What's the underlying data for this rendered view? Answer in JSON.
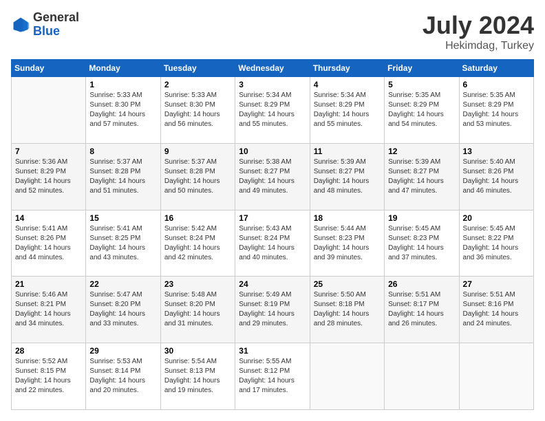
{
  "header": {
    "logo_general": "General",
    "logo_blue": "Blue",
    "title": "July 2024",
    "location": "Hekimdag, Turkey"
  },
  "weekdays": [
    "Sunday",
    "Monday",
    "Tuesday",
    "Wednesday",
    "Thursday",
    "Friday",
    "Saturday"
  ],
  "weeks": [
    [
      {
        "day": "",
        "info": ""
      },
      {
        "day": "1",
        "info": "Sunrise: 5:33 AM\nSunset: 8:30 PM\nDaylight: 14 hours\nand 57 minutes."
      },
      {
        "day": "2",
        "info": "Sunrise: 5:33 AM\nSunset: 8:30 PM\nDaylight: 14 hours\nand 56 minutes."
      },
      {
        "day": "3",
        "info": "Sunrise: 5:34 AM\nSunset: 8:29 PM\nDaylight: 14 hours\nand 55 minutes."
      },
      {
        "day": "4",
        "info": "Sunrise: 5:34 AM\nSunset: 8:29 PM\nDaylight: 14 hours\nand 55 minutes."
      },
      {
        "day": "5",
        "info": "Sunrise: 5:35 AM\nSunset: 8:29 PM\nDaylight: 14 hours\nand 54 minutes."
      },
      {
        "day": "6",
        "info": "Sunrise: 5:35 AM\nSunset: 8:29 PM\nDaylight: 14 hours\nand 53 minutes."
      }
    ],
    [
      {
        "day": "7",
        "info": "Sunrise: 5:36 AM\nSunset: 8:29 PM\nDaylight: 14 hours\nand 52 minutes."
      },
      {
        "day": "8",
        "info": "Sunrise: 5:37 AM\nSunset: 8:28 PM\nDaylight: 14 hours\nand 51 minutes."
      },
      {
        "day": "9",
        "info": "Sunrise: 5:37 AM\nSunset: 8:28 PM\nDaylight: 14 hours\nand 50 minutes."
      },
      {
        "day": "10",
        "info": "Sunrise: 5:38 AM\nSunset: 8:27 PM\nDaylight: 14 hours\nand 49 minutes."
      },
      {
        "day": "11",
        "info": "Sunrise: 5:39 AM\nSunset: 8:27 PM\nDaylight: 14 hours\nand 48 minutes."
      },
      {
        "day": "12",
        "info": "Sunrise: 5:39 AM\nSunset: 8:27 PM\nDaylight: 14 hours\nand 47 minutes."
      },
      {
        "day": "13",
        "info": "Sunrise: 5:40 AM\nSunset: 8:26 PM\nDaylight: 14 hours\nand 46 minutes."
      }
    ],
    [
      {
        "day": "14",
        "info": "Sunrise: 5:41 AM\nSunset: 8:26 PM\nDaylight: 14 hours\nand 44 minutes."
      },
      {
        "day": "15",
        "info": "Sunrise: 5:41 AM\nSunset: 8:25 PM\nDaylight: 14 hours\nand 43 minutes."
      },
      {
        "day": "16",
        "info": "Sunrise: 5:42 AM\nSunset: 8:24 PM\nDaylight: 14 hours\nand 42 minutes."
      },
      {
        "day": "17",
        "info": "Sunrise: 5:43 AM\nSunset: 8:24 PM\nDaylight: 14 hours\nand 40 minutes."
      },
      {
        "day": "18",
        "info": "Sunrise: 5:44 AM\nSunset: 8:23 PM\nDaylight: 14 hours\nand 39 minutes."
      },
      {
        "day": "19",
        "info": "Sunrise: 5:45 AM\nSunset: 8:23 PM\nDaylight: 14 hours\nand 37 minutes."
      },
      {
        "day": "20",
        "info": "Sunrise: 5:45 AM\nSunset: 8:22 PM\nDaylight: 14 hours\nand 36 minutes."
      }
    ],
    [
      {
        "day": "21",
        "info": "Sunrise: 5:46 AM\nSunset: 8:21 PM\nDaylight: 14 hours\nand 34 minutes."
      },
      {
        "day": "22",
        "info": "Sunrise: 5:47 AM\nSunset: 8:20 PM\nDaylight: 14 hours\nand 33 minutes."
      },
      {
        "day": "23",
        "info": "Sunrise: 5:48 AM\nSunset: 8:20 PM\nDaylight: 14 hours\nand 31 minutes."
      },
      {
        "day": "24",
        "info": "Sunrise: 5:49 AM\nSunset: 8:19 PM\nDaylight: 14 hours\nand 29 minutes."
      },
      {
        "day": "25",
        "info": "Sunrise: 5:50 AM\nSunset: 8:18 PM\nDaylight: 14 hours\nand 28 minutes."
      },
      {
        "day": "26",
        "info": "Sunrise: 5:51 AM\nSunset: 8:17 PM\nDaylight: 14 hours\nand 26 minutes."
      },
      {
        "day": "27",
        "info": "Sunrise: 5:51 AM\nSunset: 8:16 PM\nDaylight: 14 hours\nand 24 minutes."
      }
    ],
    [
      {
        "day": "28",
        "info": "Sunrise: 5:52 AM\nSunset: 8:15 PM\nDaylight: 14 hours\nand 22 minutes."
      },
      {
        "day": "29",
        "info": "Sunrise: 5:53 AM\nSunset: 8:14 PM\nDaylight: 14 hours\nand 20 minutes."
      },
      {
        "day": "30",
        "info": "Sunrise: 5:54 AM\nSunset: 8:13 PM\nDaylight: 14 hours\nand 19 minutes."
      },
      {
        "day": "31",
        "info": "Sunrise: 5:55 AM\nSunset: 8:12 PM\nDaylight: 14 hours\nand 17 minutes."
      },
      {
        "day": "",
        "info": ""
      },
      {
        "day": "",
        "info": ""
      },
      {
        "day": "",
        "info": ""
      }
    ]
  ]
}
